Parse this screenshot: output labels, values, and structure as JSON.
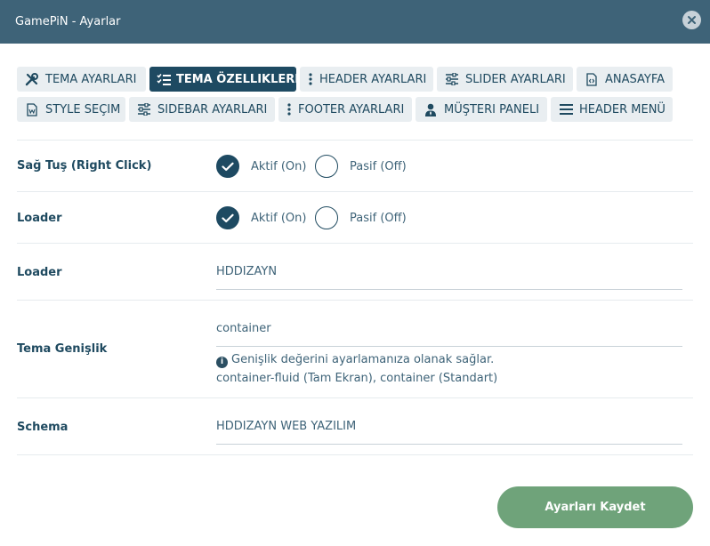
{
  "window": {
    "title": "GamePiN - Ayarlar"
  },
  "tabs": [
    {
      "label": "TEMA AYARLARI",
      "icon": "tools-icon"
    },
    {
      "label": "TEMA ÖZELLIKLERI",
      "icon": "checklist-icon",
      "active": true
    },
    {
      "label": "HEADER AYARLARI",
      "icon": "dots-vertical-icon"
    },
    {
      "label": "SLIDER AYARLARI",
      "icon": "sliders-icon"
    },
    {
      "label": "ANASAYFA",
      "icon": "file-code-icon"
    },
    {
      "label": "STYLE SEÇIM",
      "icon": "file-word-icon"
    },
    {
      "label": "SIDEBAR AYARLARI",
      "icon": "sliders-icon"
    },
    {
      "label": "FOOTER AYARLARI",
      "icon": "dots-vertical-icon"
    },
    {
      "label": "MÜŞTERI PANELI",
      "icon": "user-tie-icon"
    },
    {
      "label": "HEADER MENÜ",
      "icon": "bars-icon"
    }
  ],
  "settings": {
    "right_click": {
      "label": "Sağ Tuş (Right Click)",
      "on_label": "Aktif (On)",
      "off_label": "Pasif (Off)",
      "selected": "on"
    },
    "loader_toggle": {
      "label": "Loader",
      "on_label": "Aktif (On)",
      "off_label": "Pasif (Off)",
      "selected": "on"
    },
    "loader_text": {
      "label": "Loader",
      "value": "HDDIZAYN"
    },
    "theme_width": {
      "label": "Tema Genişlik",
      "value": "container",
      "help_line1": "Genişlik değerini ayarlamanıza olanak sağlar.",
      "help_line2": "container-fluid (Tam Ekran), container (Standart)"
    },
    "schema": {
      "label": "Schema",
      "value": "HDDIZAYN WEB YAZILIM"
    }
  },
  "save_button": {
    "label": "Ayarları Kaydet"
  },
  "colors": {
    "header": "#3e6378",
    "primary": "#1e4a62",
    "tab_bg": "#e9eef1",
    "save": "#6fa37a"
  }
}
